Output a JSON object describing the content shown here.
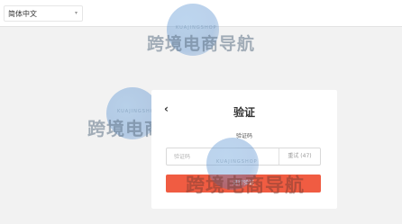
{
  "header": {
    "language": "简体中文",
    "language_caret": "▾"
  },
  "watermark": {
    "text": "跨境电商导航",
    "subtext": "KUAJINGSHOP"
  },
  "verify": {
    "back": "‹",
    "title": "验证",
    "code_label": "验证码",
    "code_placeholder": "验证码",
    "retry": "重试 (47)",
    "submit": "进行验证"
  },
  "colors": {
    "accent": "#f05c42",
    "background": "#f2f2f2"
  }
}
